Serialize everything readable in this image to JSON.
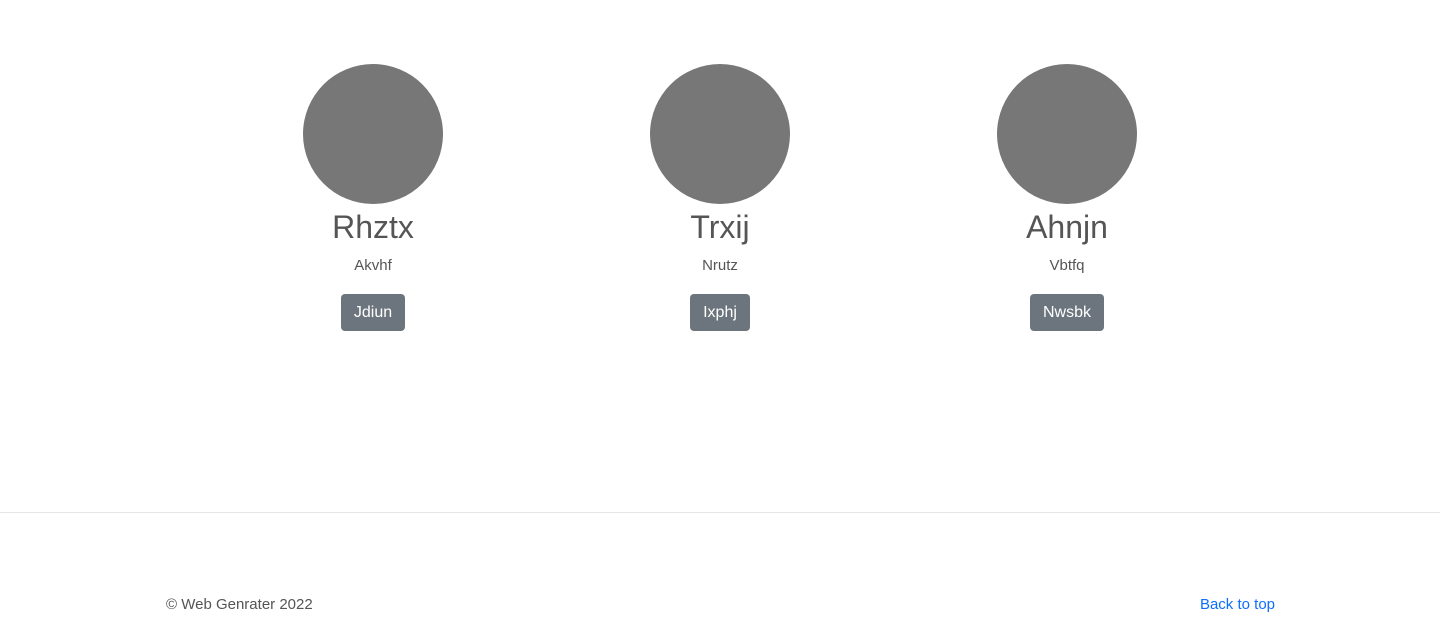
{
  "cards": [
    {
      "name": "Rhztx",
      "subtitle": "Akvhf",
      "button_label": "Jdiun"
    },
    {
      "name": "Trxij",
      "subtitle": "Nrutz",
      "button_label": "Ixphj"
    },
    {
      "name": "Ahnjn",
      "subtitle": "Vbtfq",
      "button_label": "Nwsbk"
    }
  ],
  "footer": {
    "copyright": "© Web Genrater 2022",
    "back_to_top": "Back to top"
  },
  "colors": {
    "avatar": "#777777",
    "button": "#6c757d",
    "link": "#0d6efd"
  }
}
